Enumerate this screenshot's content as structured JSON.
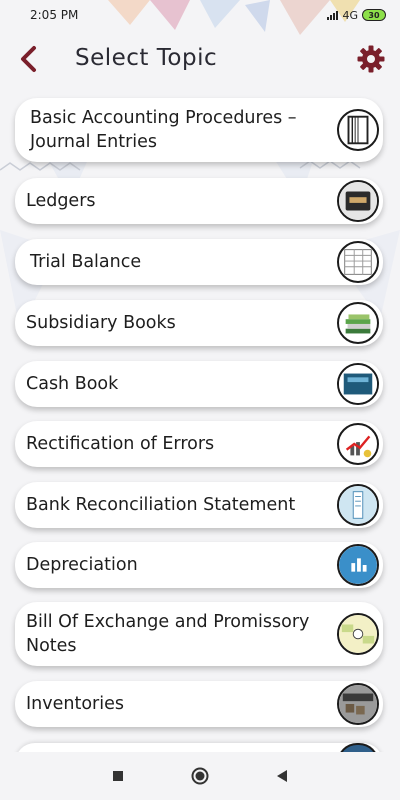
{
  "status_bar": {
    "time": "2:05 PM",
    "network": "4G",
    "battery": "30"
  },
  "header": {
    "title": "Select Topic",
    "back_icon": "chevron-left-icon",
    "settings_icon": "gear-icon"
  },
  "topics": [
    {
      "label": "Basic Accounting Procedures – Journal Entries",
      "icon": "notebook-icon"
    },
    {
      "label": "Ledgers",
      "icon": "ledger-book-icon"
    },
    {
      "label": "Trial Balance",
      "icon": "spreadsheet-icon"
    },
    {
      "label": "Subsidiary Books",
      "icon": "book-stack-icon"
    },
    {
      "label": "Cash Book",
      "icon": "cash-book-icon"
    },
    {
      "label": "Rectification of Errors",
      "icon": "rising-chart-icon"
    },
    {
      "label": "Bank Reconciliation Statement",
      "icon": "bank-statement-icon"
    },
    {
      "label": "Depreciation",
      "icon": "bar-chart-icon"
    },
    {
      "label": "Bill Of Exchange and Promissory Notes",
      "icon": "bill-vs-note-icon"
    },
    {
      "label": "Inventories",
      "icon": "inventory-icon"
    }
  ],
  "nav": {
    "recents_icon": "square-icon",
    "home_icon": "circle-icon",
    "back_icon": "triangle-back-icon"
  },
  "colors": {
    "accent": "#7a1f2b",
    "title_text": "#2a2a33"
  }
}
